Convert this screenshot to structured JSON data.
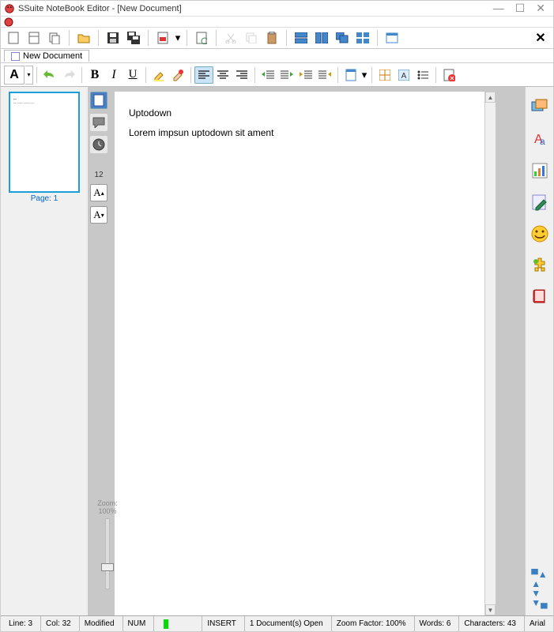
{
  "title": "SSuite NoteBook Editor - [New Document]",
  "tab_label": "New Document",
  "thumb_label": "Page:  1",
  "zoom_label": "Zoom:",
  "zoom_value": "100%",
  "font_size_label": "12",
  "font_letter": "A",
  "doc": {
    "line1": "Uptodown",
    "line2": "Lorem impsun uptodown sit ament"
  },
  "status": {
    "line": "Line:  3",
    "col": "Col:  32",
    "modified": "Modified",
    "num": "NUM",
    "insert": "INSERT",
    "docs_open": "1 Document(s) Open",
    "zoom": "Zoom Factor: 100%",
    "words": "Words:  6",
    "chars": "Characters:  43",
    "font": "Arial"
  }
}
